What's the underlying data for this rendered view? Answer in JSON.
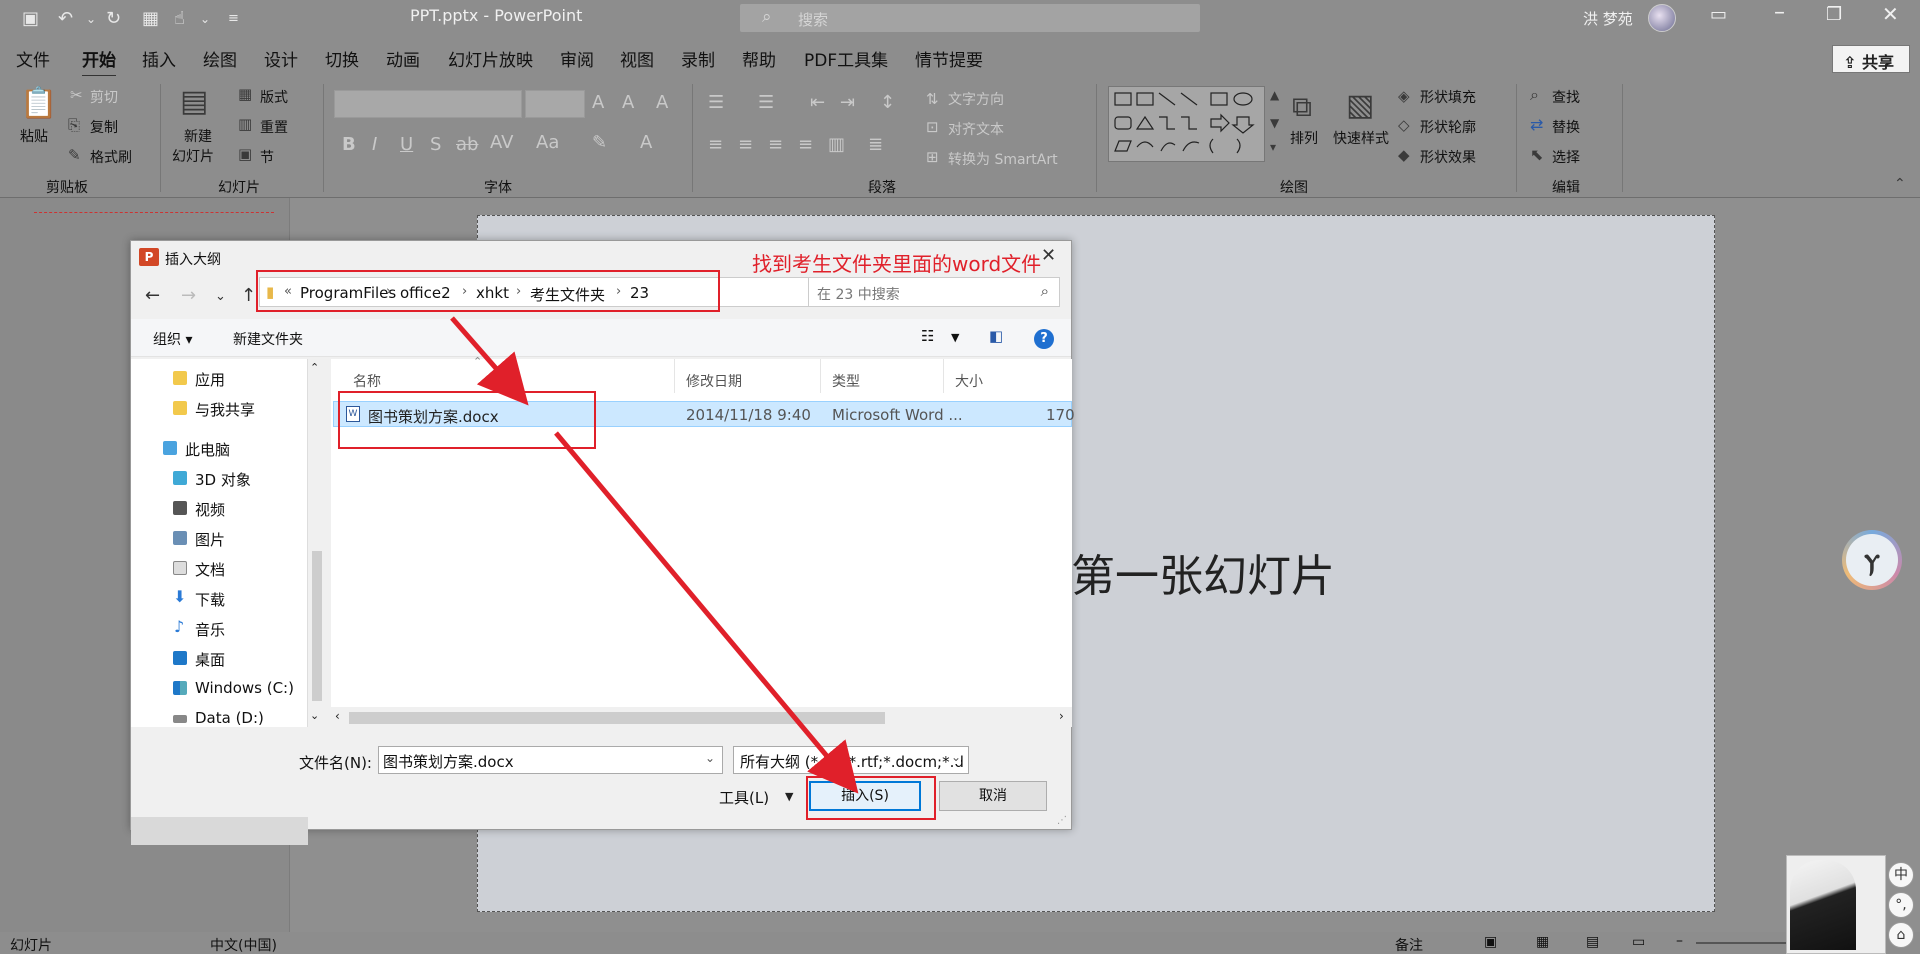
{
  "app": {
    "document_title": "PPT.pptx  -  PowerPoint",
    "search_placeholder": "搜索",
    "user_name": "洪 梦苑",
    "share_label": "共享"
  },
  "tabs": [
    "文件",
    "开始",
    "插入",
    "绘图",
    "设计",
    "切换",
    "动画",
    "幻灯片放映",
    "审阅",
    "视图",
    "录制",
    "帮助",
    "PDF工具集",
    "情节提要"
  ],
  "ribbon": {
    "clipboard": {
      "paste": "粘贴",
      "cut": "剪切",
      "copy": "复制",
      "format_painter": "格式刷",
      "group": "剪贴板"
    },
    "slides": {
      "new_slide_1": "新建",
      "new_slide_2": "幻灯片",
      "layout": "版式",
      "reset": "重置",
      "section": "节",
      "group": "幻灯片"
    },
    "font": {
      "group": "字体"
    },
    "paragraph": {
      "text_direction": "文字方向",
      "align_text": "对齐文本",
      "smartart": "转换为 SmartArt",
      "group": "段落"
    },
    "drawing": {
      "arrange": "排列",
      "quick_styles": "快速样式",
      "shape_fill": "形状填充",
      "shape_outline": "形状轮廓",
      "shape_effects": "形状效果",
      "group": "绘图"
    },
    "editing": {
      "find": "查找",
      "replace": "替换",
      "select": "选择",
      "group": "编辑"
    }
  },
  "slide": {
    "title_text": "第一张幻灯片"
  },
  "statusbar": {
    "slide_label": "幻灯片",
    "language": "中文(中国)",
    "notes": "备注"
  },
  "ime": {
    "mode": "中",
    "punct": "°,",
    "skin": "⌂"
  },
  "dialog": {
    "title": "插入大纲",
    "app_icon": "P",
    "path": [
      "ProgramFiles",
      "office2",
      "xhkt",
      "考生文件夹",
      "23"
    ],
    "path_prefix": "«",
    "search_placeholder": "在 23 中搜索",
    "organize": "组织 ▾",
    "new_folder": "新建文件夹",
    "help": "?",
    "nav_items": [
      {
        "label": "应用"
      },
      {
        "label": "与我共享"
      },
      {
        "label": "此电脑"
      },
      {
        "label": "3D 对象"
      },
      {
        "label": "视频"
      },
      {
        "label": "图片"
      },
      {
        "label": "文档"
      },
      {
        "label": "下载"
      },
      {
        "label": "音乐"
      },
      {
        "label": "桌面"
      },
      {
        "label": "Windows (C:)"
      },
      {
        "label": "Data (D:)"
      }
    ],
    "columns": [
      "名称",
      "修改日期",
      "类型",
      "大小"
    ],
    "files": [
      {
        "name": "图书策划方案.docx",
        "modified": "2014/11/18 9:40",
        "type": "Microsoft Word ...",
        "size": "170"
      }
    ],
    "filename_label": "文件名(N):",
    "filename_value": "图书策划方案.docx",
    "filetype_value": "所有大纲 (*.txt;*.rtf;*.docm;*.d",
    "tools_label": "工具(L)",
    "insert_label": "插入(S)",
    "cancel_label": "取消"
  },
  "annotation": {
    "text": "找到考生文件夹里面的word文件",
    "color": "#e0202a"
  }
}
